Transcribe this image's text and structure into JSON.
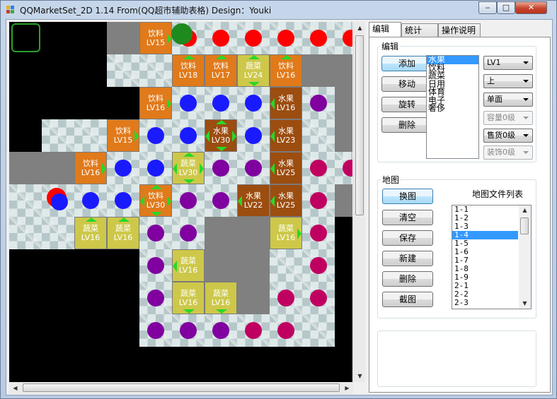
{
  "window": {
    "title": "QQMarketSet_2D 1.14 From(QQ超市辅助表格)  Design：Youki",
    "minimize": "‒",
    "maximize": "□",
    "close": "✕"
  },
  "tabs": [
    "编辑",
    "统计",
    "操作说明"
  ],
  "edit": {
    "group_label": "编辑",
    "buttons": [
      "添加",
      "移动",
      "旋转",
      "删除"
    ],
    "categories": [
      "水果",
      "饮料",
      "蔬菜",
      "日用",
      "体育",
      "电子",
      "奢侈"
    ],
    "selected_category": "水果",
    "combos": [
      "LV1",
      "上",
      "单面",
      "容量0级",
      "售货0级",
      "装饰0级"
    ]
  },
  "map": {
    "group_label": "地图",
    "list_label": "地图文件列表",
    "buttons": [
      "换图",
      "清空",
      "保存",
      "新建",
      "删除",
      "截图"
    ],
    "files": [
      "1-1",
      "1-2",
      "1-3",
      "1-4",
      "1-5",
      "1-6",
      "1-7",
      "1-8",
      "1-9",
      "2-1",
      "2-2",
      "2-3"
    ],
    "selected_file": "1-4"
  },
  "board": {
    "shelves": [
      {
        "c": 4,
        "r": 0,
        "type": "drink",
        "name": "饮料",
        "level": "LV15",
        "arrows": [
          "r"
        ]
      },
      {
        "c": 5,
        "r": 1,
        "type": "drink",
        "name": "饮料",
        "level": "LV18",
        "arrows": [
          "u"
        ]
      },
      {
        "c": 6,
        "r": 1,
        "type": "drink",
        "name": "饮料",
        "level": "LV17",
        "arrows": [
          "u"
        ]
      },
      {
        "c": 7,
        "r": 1,
        "type": "veg",
        "name": "蔬菜",
        "level": "LV24",
        "arrows": [
          "u",
          "d"
        ]
      },
      {
        "c": 8,
        "r": 1,
        "type": "drink",
        "name": "饮料",
        "level": "LV16",
        "arrows": [
          "u"
        ]
      },
      {
        "c": 4,
        "r": 2,
        "type": "drink",
        "name": "饮料",
        "level": "LV16",
        "arrows": [
          "r"
        ]
      },
      {
        "c": 8,
        "r": 2,
        "type": "fruit",
        "name": "水果",
        "level": "LV16",
        "arrows": [
          "l"
        ]
      },
      {
        "c": 3,
        "r": 3,
        "type": "drink",
        "name": "饮料",
        "level": "LV15",
        "arrows": [
          "r"
        ]
      },
      {
        "c": 6,
        "r": 3,
        "type": "fruit",
        "name": "水果",
        "level": "LV30",
        "arrows": [
          "u",
          "d",
          "l",
          "r"
        ]
      },
      {
        "c": 8,
        "r": 3,
        "type": "fruit",
        "name": "水果",
        "level": "LV23",
        "arrows": [
          "l"
        ]
      },
      {
        "c": 2,
        "r": 4,
        "type": "drink",
        "name": "饮料",
        "level": "LV16",
        "arrows": [
          "r"
        ]
      },
      {
        "c": 5,
        "r": 4,
        "type": "veg",
        "name": "蔬菜",
        "level": "LV30",
        "arrows": [
          "u",
          "d",
          "l",
          "r"
        ]
      },
      {
        "c": 8,
        "r": 4,
        "type": "fruit",
        "name": "水果",
        "level": "LV25",
        "arrows": [
          "l"
        ]
      },
      {
        "c": 4,
        "r": 5,
        "type": "drink",
        "name": "饮料",
        "level": "LV30",
        "arrows": [
          "u",
          "d",
          "l",
          "r"
        ]
      },
      {
        "c": 7,
        "r": 5,
        "type": "fruit",
        "name": "水果",
        "level": "LV22",
        "arrows": [
          "l"
        ]
      },
      {
        "c": 8,
        "r": 5,
        "type": "fruit",
        "name": "水果",
        "level": "LV25",
        "arrows": [
          "l"
        ]
      },
      {
        "c": 2,
        "r": 6,
        "type": "veg",
        "name": "蔬菜",
        "level": "LV16",
        "arrows": [
          "u"
        ]
      },
      {
        "c": 3,
        "r": 6,
        "type": "veg",
        "name": "蔬菜",
        "level": "LV16",
        "arrows": [
          "u"
        ]
      },
      {
        "c": 8,
        "r": 6,
        "type": "veg",
        "name": "蔬菜",
        "level": "LV16",
        "arrows": [
          "r"
        ]
      },
      {
        "c": 5,
        "r": 7,
        "type": "veg",
        "name": "蔬菜",
        "level": "LV16",
        "arrows": [
          "l"
        ]
      },
      {
        "c": 5,
        "r": 8,
        "type": "veg",
        "name": "蔬菜",
        "level": "LV16",
        "arrows": [
          "d"
        ]
      },
      {
        "c": 6,
        "r": 8,
        "type": "veg",
        "name": "蔬菜",
        "level": "LV16",
        "arrows": [
          "d"
        ]
      }
    ]
  }
}
